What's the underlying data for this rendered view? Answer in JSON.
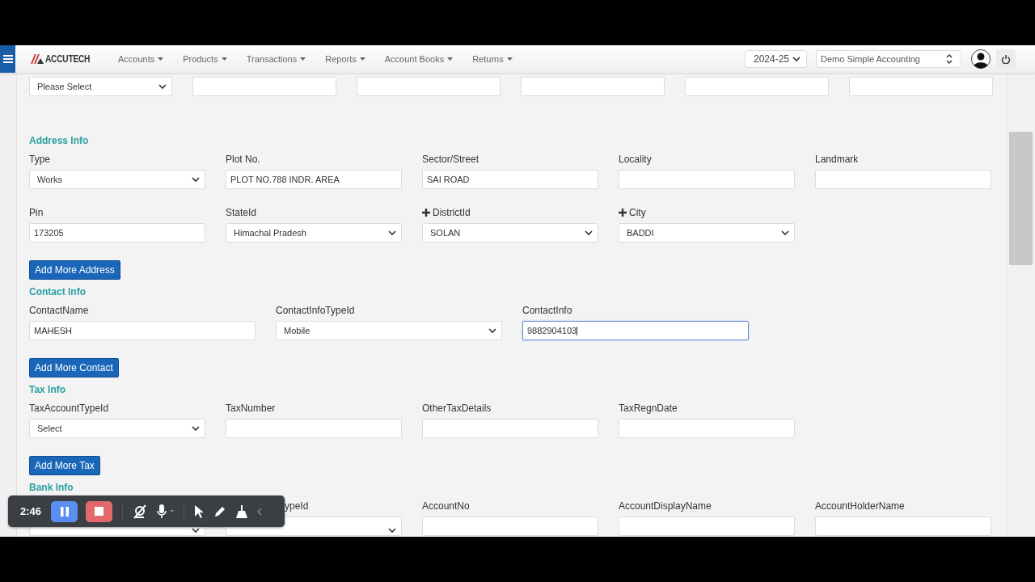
{
  "navbar": {
    "brand": "ACCUTECH",
    "menus": [
      "Accounts",
      "Products",
      "Transactions",
      "Reports",
      "Account Books",
      "Returns"
    ],
    "year": "2024-25",
    "company": "Demo Simple Accounting"
  },
  "top_row": [
    {
      "kind": "select",
      "value": "Please Select"
    },
    {
      "kind": "input"
    },
    {
      "kind": "input"
    },
    {
      "kind": "input"
    },
    {
      "kind": "input"
    },
    {
      "kind": "input"
    }
  ],
  "sections": [
    {
      "kind": "address",
      "title": "Address Info",
      "rows": [
        [
          {
            "label": "Type",
            "kind": "select",
            "value": "Works"
          },
          {
            "label": "Plot No.",
            "kind": "input",
            "value": "PLOT NO.788 INDR. AREA"
          },
          {
            "label": "Sector/Street",
            "kind": "input",
            "value": "SAI ROAD"
          },
          {
            "label": "Locality",
            "kind": "input"
          },
          {
            "label": "Landmark",
            "kind": "input"
          }
        ],
        [
          {
            "label": "Pin",
            "kind": "input",
            "value": "173205"
          },
          {
            "label": "StateId",
            "kind": "select",
            "value": "Himachal Pradesh"
          },
          {
            "label": "DistrictId",
            "kind": "select",
            "value": "SOLAN",
            "plus": true
          },
          {
            "label": "City",
            "kind": "select",
            "value": "BADDI",
            "plus": true
          }
        ]
      ],
      "button": "Add More Address"
    },
    {
      "kind": "contact",
      "title": "Contact Info",
      "rows": [
        [
          {
            "label": "ContactName",
            "kind": "input",
            "value": "MAHESH",
            "focused": false
          },
          {
            "label": "ContactInfoTypeId",
            "kind": "select",
            "value": "Mobile",
            "focused": false
          },
          {
            "label": "ContactInfo",
            "kind": "input",
            "value": "9882904103",
            "focused": true
          }
        ]
      ],
      "button": "Add More Contact"
    },
    {
      "kind": "tax",
      "title": "Tax Info",
      "rows": [
        [
          {
            "label": "TaxAccountTypeId",
            "kind": "select",
            "value": "Select"
          },
          {
            "label": "TaxNumber",
            "kind": "input"
          },
          {
            "label": "OtherTaxDetails",
            "kind": "input"
          },
          {
            "label": "TaxRegnDate",
            "kind": "input"
          }
        ]
      ],
      "button": "Add More Tax"
    },
    {
      "kind": "bank",
      "title": "Bank Info",
      "rows": [
        [
          {
            "kind": "select"
          },
          {
            "label": "ypeId",
            "kind": "select",
            "cut": true
          },
          {
            "label": "AccountNo",
            "kind": "input"
          },
          {
            "label": "AccountDisplayName",
            "kind": "input"
          },
          {
            "label": "AccountHolderName",
            "kind": "input"
          }
        ]
      ]
    }
  ],
  "recorder": {
    "time": "2:46"
  }
}
